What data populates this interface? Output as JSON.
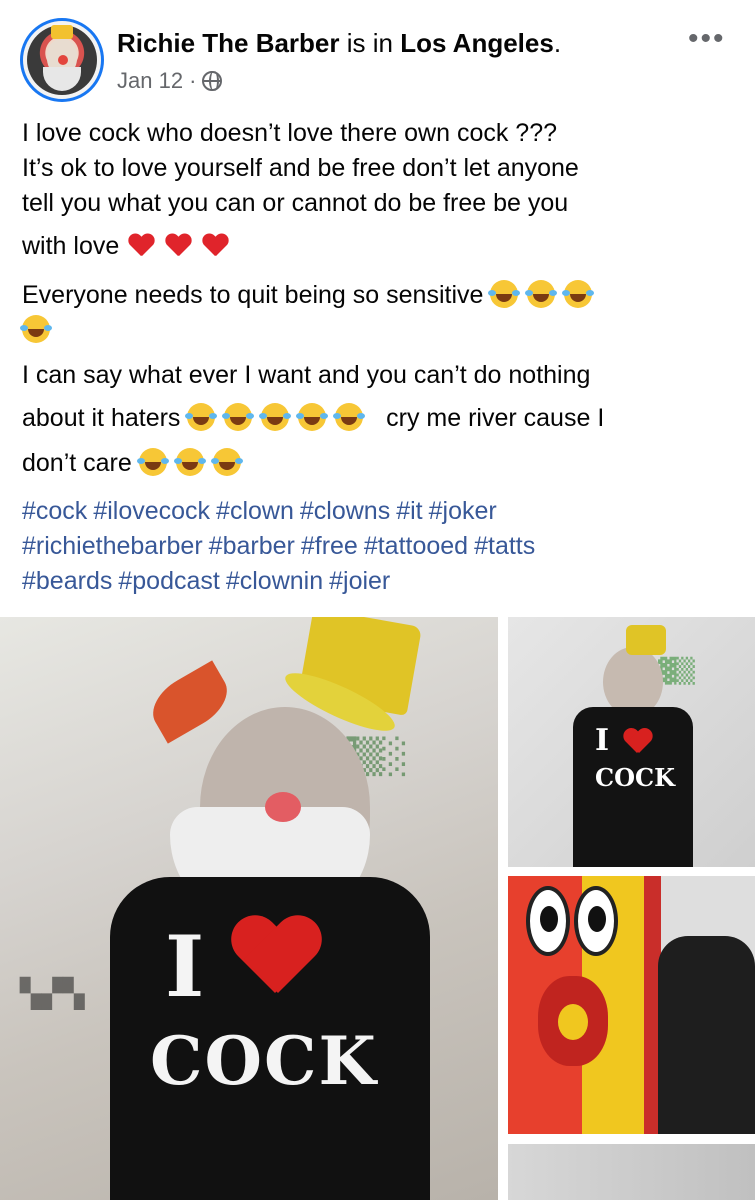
{
  "post": {
    "author": "Richie The Barber",
    "connector": " is in ",
    "location": "Los Angeles",
    "location_suffix": ".",
    "date": "Jan 12",
    "separator": "·",
    "privacy_icon": "globe-icon",
    "more_icon": "more-options-icon",
    "more_glyph": "•••"
  },
  "text": {
    "line1": "I love cock who doesn’t love there own cock ???",
    "line2": "It’s ok to love yourself and be free don’t let anyone",
    "line3": "tell you what you can or cannot do be free be you",
    "line4": "with love",
    "line5": "Everyone needs to quit being so sensitive",
    "line6": "I can say what ever I want and you can’t do nothing",
    "line7": "about it haters",
    "line7b": "cry me river cause I",
    "line8": "don’t care"
  },
  "hashtags": [
    "#cock",
    "#ilovecock",
    "#clown",
    "#clowns",
    "#it",
    "#joker",
    "#richiethebarber",
    "#barber",
    "#free",
    "#tattooed",
    "#tatts",
    "#beards",
    "#podcast",
    "#clownin",
    "#joier"
  ],
  "photo_text": {
    "shirt_letter": "I",
    "shirt_word": "COCK",
    "mini_letter": "I",
    "mini_word": "COCK"
  },
  "colors": {
    "link": "#385898",
    "accent": "#1877f2",
    "secondary_text": "#65676b",
    "heart": "#e0242b"
  }
}
